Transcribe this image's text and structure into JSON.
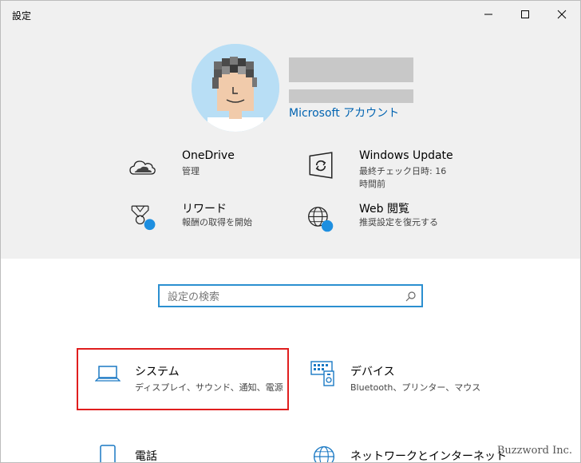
{
  "window": {
    "title": "設定"
  },
  "account": {
    "link": "Microsoft アカウント"
  },
  "quick_items": [
    {
      "title": "OneDrive",
      "sub": "管理",
      "icon": "cloud-icon"
    },
    {
      "title": "Windows Update",
      "sub": "最終チェック日時: 16 時間前",
      "icon": "sync-icon"
    },
    {
      "title": "リワード",
      "sub": "報酬の取得を開始",
      "icon": "rewards-icon"
    },
    {
      "title": "Web 閲覧",
      "sub": "推奨設定を復元する",
      "icon": "globe-icon"
    }
  ],
  "search": {
    "placeholder": "設定の検索"
  },
  "tiles": [
    {
      "title": "システム",
      "sub": "ディスプレイ、サウンド、通知、電源",
      "icon": "laptop-icon"
    },
    {
      "title": "デバイス",
      "sub": "Bluetooth、プリンター、マウス",
      "icon": "devices-icon"
    },
    {
      "title": "電話",
      "sub": "",
      "icon": "phone-icon"
    },
    {
      "title": "ネットワークとインターネット",
      "sub": "",
      "icon": "globe-icon"
    }
  ],
  "watermark": "Buzzword Inc.",
  "colors": {
    "accent": "#0063b1",
    "highlight": "#e01e1e",
    "header_bg": "#f0f0f0"
  }
}
